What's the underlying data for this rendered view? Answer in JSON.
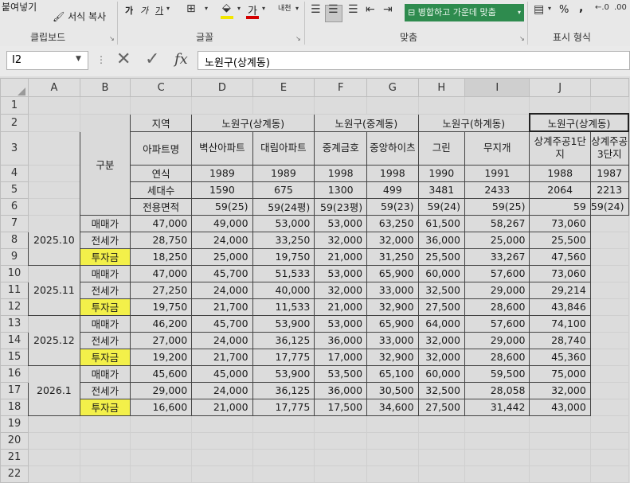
{
  "ribbon": {
    "paste_label": "붙여넣기",
    "format_painter_label": "서식 복사",
    "font_bold": "가",
    "font_italic": "가",
    "font_underline": "가",
    "font_color_letter": "가",
    "phonetic_label": "내천",
    "merge_center_label": "병합하고 가운데 맞춤",
    "percent_label": "%",
    "comma_label": ",",
    "groups": [
      "클립보드",
      "글꼴",
      "맞춤",
      "표시 형식"
    ],
    "accent_green": "#2e8b4e"
  },
  "formula_bar": {
    "name_box": "I2",
    "fx_label": "fx",
    "content": "노원구(상계동)"
  },
  "columns": [
    "A",
    "B",
    "C",
    "D",
    "E",
    "F",
    "G",
    "H",
    "I",
    "J"
  ],
  "row_numbers": [
    "1",
    "2",
    "3",
    "4",
    "5",
    "6",
    "7",
    "8",
    "9",
    "10",
    "11",
    "12",
    "13",
    "14",
    "15",
    "16",
    "17",
    "18",
    "19",
    "20",
    "21",
    "22"
  ],
  "table": {
    "gubun": "구분",
    "region_label": "지역",
    "regions": [
      "노원구(상계동)",
      "노원구(중계동)",
      "노원구(하계동)",
      "노원구(상계동)"
    ],
    "apt_label": "아파트명",
    "apts": [
      "벽산아파트",
      "대림아파트",
      "중계금호",
      "중앙하이츠",
      "그린",
      "무지개",
      "상계주공1단지",
      "상계주공3단지"
    ],
    "year_label": "연식",
    "years": [
      "1989",
      "1989",
      "1998",
      "1998",
      "1990",
      "1991",
      "1988",
      "1987"
    ],
    "households_label": "세대수",
    "households": [
      "1590",
      "675",
      "1300",
      "499",
      "3481",
      "2433",
      "2064",
      "2213"
    ],
    "area_label": "전용면적",
    "areas": [
      "59(25)",
      "59(24평)",
      "59(23평)",
      "59(23)",
      "59(24)",
      "59(25)",
      "59",
      "59(24)"
    ],
    "row_labels": [
      "매매가",
      "전세가",
      "투자금"
    ],
    "periods": [
      {
        "date": "2025.10",
        "rows": [
          [
            "47,000",
            "49,000",
            "53,000",
            "53,000",
            "63,250",
            "61,500",
            "58,267",
            "73,060"
          ],
          [
            "28,750",
            "24,000",
            "33,250",
            "32,000",
            "32,000",
            "36,000",
            "25,000",
            "25,500"
          ],
          [
            "18,250",
            "25,000",
            "19,750",
            "21,000",
            "31,250",
            "25,500",
            "33,267",
            "47,560"
          ]
        ]
      },
      {
        "date": "2025.11",
        "rows": [
          [
            "47,000",
            "45,700",
            "51,533",
            "53,000",
            "65,900",
            "60,000",
            "57,600",
            "73,060"
          ],
          [
            "27,250",
            "24,000",
            "40,000",
            "32,000",
            "33,000",
            "32,500",
            "29,000",
            "29,214"
          ],
          [
            "19,750",
            "21,700",
            "11,533",
            "21,000",
            "32,900",
            "27,500",
            "28,600",
            "43,846"
          ]
        ]
      },
      {
        "date": "2025.12",
        "rows": [
          [
            "46,200",
            "45,700",
            "53,900",
            "53,000",
            "65,900",
            "64,000",
            "57,600",
            "74,100"
          ],
          [
            "27,000",
            "24,000",
            "36,125",
            "36,000",
            "33,000",
            "32,000",
            "29,000",
            "28,740"
          ],
          [
            "19,200",
            "21,700",
            "17,775",
            "17,000",
            "32,900",
            "32,000",
            "28,600",
            "45,360"
          ]
        ]
      },
      {
        "date": "2026.1",
        "rows": [
          [
            "45,600",
            "45,000",
            "53,900",
            "53,500",
            "65,100",
            "60,000",
            "59,500",
            "75,000"
          ],
          [
            "29,000",
            "24,000",
            "36,125",
            "36,000",
            "30,500",
            "32,500",
            "28,058",
            "32,000"
          ],
          [
            "16,600",
            "21,000",
            "17,775",
            "17,500",
            "34,600",
            "27,500",
            "31,442",
            "43,000"
          ]
        ]
      }
    ]
  }
}
